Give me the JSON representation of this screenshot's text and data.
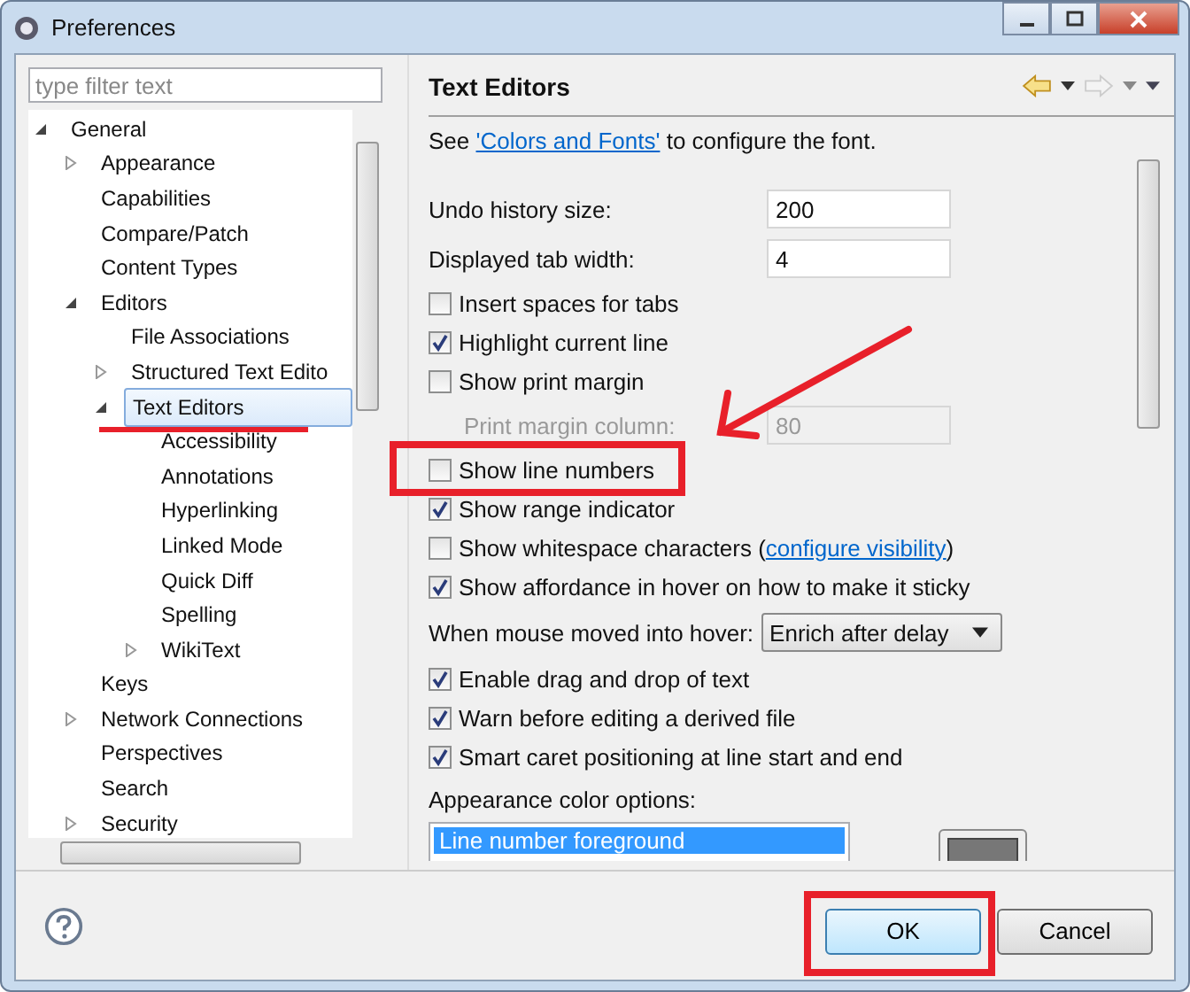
{
  "window": {
    "title": "Preferences"
  },
  "filter": {
    "placeholder": "type filter text"
  },
  "tree": [
    {
      "label": "General",
      "expanded": true,
      "selected": false,
      "children": [
        {
          "label": "Appearance",
          "expanded": false,
          "selected": false
        },
        {
          "label": "Capabilities",
          "selected": false
        },
        {
          "label": "Compare/Patch",
          "selected": false
        },
        {
          "label": "Content Types",
          "selected": false
        },
        {
          "label": "Editors",
          "expanded": true,
          "selected": false,
          "children": [
            {
              "label": "File Associations",
              "selected": false
            },
            {
              "label": "Structured Text Edito",
              "expanded": false,
              "selected": false
            },
            {
              "label": "Text Editors",
              "expanded": true,
              "selected": true,
              "children": [
                {
                  "label": "Accessibility",
                  "selected": false
                },
                {
                  "label": "Annotations",
                  "selected": false
                },
                {
                  "label": "Hyperlinking",
                  "selected": false
                },
                {
                  "label": "Linked Mode",
                  "selected": false
                },
                {
                  "label": "Quick Diff",
                  "selected": false
                },
                {
                  "label": "Spelling",
                  "selected": false
                },
                {
                  "label": "WikiText",
                  "expanded": false,
                  "selected": false
                }
              ]
            }
          ]
        },
        {
          "label": "Keys",
          "selected": false
        },
        {
          "label": "Network Connections",
          "expanded": false,
          "selected": false
        },
        {
          "label": "Perspectives",
          "selected": false
        },
        {
          "label": "Search",
          "selected": false
        },
        {
          "label": "Security",
          "expanded": false,
          "selected": false
        }
      ]
    }
  ],
  "page": {
    "title": "Text Editors",
    "hint": {
      "before": "See ",
      "link": "'Colors and Fonts'",
      "after": " to configure the font."
    },
    "settings": [
      {
        "kind": "field",
        "label": "Undo history size:",
        "value": "200",
        "disabled": false
      },
      {
        "kind": "field",
        "label": "Displayed tab width:",
        "value": "4",
        "disabled": false
      },
      {
        "kind": "check",
        "label": "Insert spaces for tabs",
        "checked": false
      },
      {
        "kind": "check",
        "label": "Highlight current line",
        "checked": true
      },
      {
        "kind": "check",
        "label": "Show print margin",
        "checked": false
      },
      {
        "kind": "field",
        "label": "Print margin column:",
        "value": "80",
        "disabled": true
      },
      {
        "kind": "check",
        "label": "Show line numbers",
        "checked": false
      },
      {
        "kind": "check",
        "label": "Show range indicator",
        "checked": true
      },
      {
        "kind": "check",
        "label": "Show whitespace characters (",
        "link": "configure visibility",
        "after": ")",
        "checked": false
      },
      {
        "kind": "check",
        "label": "Show affordance in hover on how to make it sticky",
        "checked": true
      },
      {
        "kind": "select",
        "label": "When mouse moved into hover:",
        "value": "Enrich after delay"
      },
      {
        "kind": "check",
        "label": "Enable drag and drop of text",
        "checked": true
      },
      {
        "kind": "check",
        "label": "Warn before editing a derived file",
        "checked": true
      },
      {
        "kind": "check",
        "label": "Smart caret positioning at line start and end",
        "checked": true
      }
    ],
    "colors": {
      "label": "Appearance color options:",
      "items": [
        {
          "label": "Line number foreground",
          "selected": true
        }
      ]
    }
  },
  "buttons": [
    {
      "label": "OK"
    },
    {
      "label": "Cancel"
    }
  ]
}
